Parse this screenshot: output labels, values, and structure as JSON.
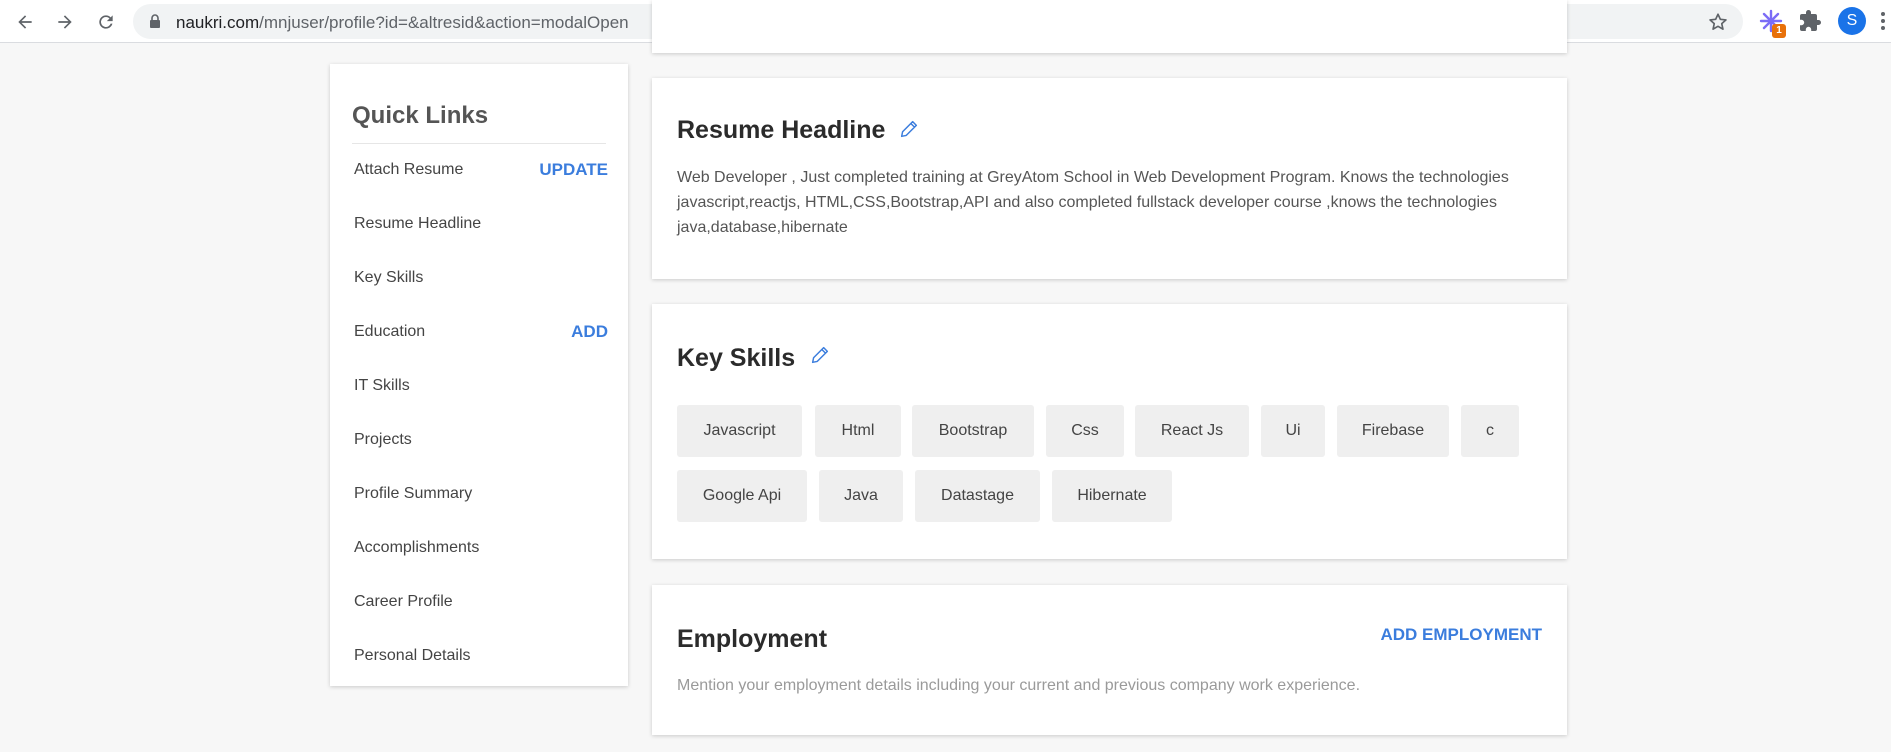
{
  "browser": {
    "url_domain": "naukri.com",
    "url_path": "/mnjuser/profile?id=&altresid&action=modalOpen",
    "extension_badge": "1",
    "profile_initial": "S"
  },
  "quick_links": {
    "title": "Quick Links",
    "items": [
      {
        "label": "Attach Resume",
        "action": "UPDATE"
      },
      {
        "label": "Resume Headline",
        "action": ""
      },
      {
        "label": "Key Skills",
        "action": ""
      },
      {
        "label": "Education",
        "action": "ADD"
      },
      {
        "label": "IT Skills",
        "action": ""
      },
      {
        "label": "Projects",
        "action": ""
      },
      {
        "label": "Profile Summary",
        "action": ""
      },
      {
        "label": "Accomplishments",
        "action": ""
      },
      {
        "label": "Career Profile",
        "action": ""
      },
      {
        "label": "Personal Details",
        "action": ""
      }
    ]
  },
  "resume_headline": {
    "title": "Resume Headline",
    "text": "Web Developer , Just completed training at GreyAtom School in Web Development Program. Knows the technologies javascript,reactjs, HTML,CSS,Bootstrap,API and also completed fullstack developer course ,knows the technologies java,database,hibernate"
  },
  "key_skills": {
    "title": "Key Skills",
    "skills": [
      "Javascript",
      "Html",
      "Bootstrap",
      "Css",
      "React Js",
      "Ui",
      "Firebase",
      "c",
      "Google Api",
      "Java",
      "Datastage",
      "Hibernate"
    ]
  },
  "employment": {
    "title": "Employment",
    "action": "ADD EMPLOYMENT",
    "description": "Mention your employment details including your current and previous company work experience."
  },
  "colors": {
    "accent": "#3b7ddd",
    "chip_bg": "#efefef",
    "page_bg": "#f7f7f7"
  }
}
